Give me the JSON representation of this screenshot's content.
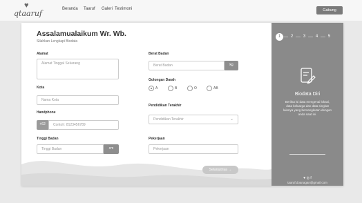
{
  "brand": {
    "logo_text": "qtaaruf"
  },
  "nav": {
    "links": [
      "Beranda",
      "Taaruf",
      "Galeri",
      "Testimoni"
    ],
    "login_label": "Gabung"
  },
  "form": {
    "greeting": "Assalamualaikum Wr. Wb.",
    "subtitle": "Silahkan Lengkapi Biodata",
    "address": {
      "label": "Alamat",
      "placeholder": "Alamat Tinggal Sekarang"
    },
    "city": {
      "label": "Kota",
      "placeholder": "Nama Kota"
    },
    "phone": {
      "label": "Handphone",
      "prefix": "+62",
      "placeholder": "Contoh: 8123456789"
    },
    "height": {
      "label": "Tinggi Badan",
      "placeholder": "Tinggi Badan",
      "unit": "cm"
    },
    "weight": {
      "label": "Berat Badan",
      "placeholder": "Berat Badan",
      "unit": "kg"
    },
    "blood": {
      "label": "Golongan Darah",
      "options": [
        "A",
        "B",
        "O",
        "AB"
      ],
      "selected": "A"
    },
    "education": {
      "label": "Pendidikan Terakhir",
      "placeholder": "Pendidikan Terakhir"
    },
    "job": {
      "label": "Pekerjaan",
      "placeholder": "Pekerjaan"
    },
    "next_label": "Selanjutnya →"
  },
  "panel": {
    "steps": [
      "1",
      "2",
      "3",
      "4",
      "5"
    ],
    "active_step": 1,
    "title": "Biodata Diri",
    "description": "Berikut isi data mengenai lokasi, data keluarga dan data singkat lainnya yang bersangkutan dengan anda saat ini.",
    "social": "♥ ◎ f",
    "email": "taaruf.doanagan@gmail.com"
  },
  "colors": {
    "panel_bg": "#8a8a8a",
    "button_gray": "#7a7a7a",
    "wave": "#e2e2e2"
  }
}
